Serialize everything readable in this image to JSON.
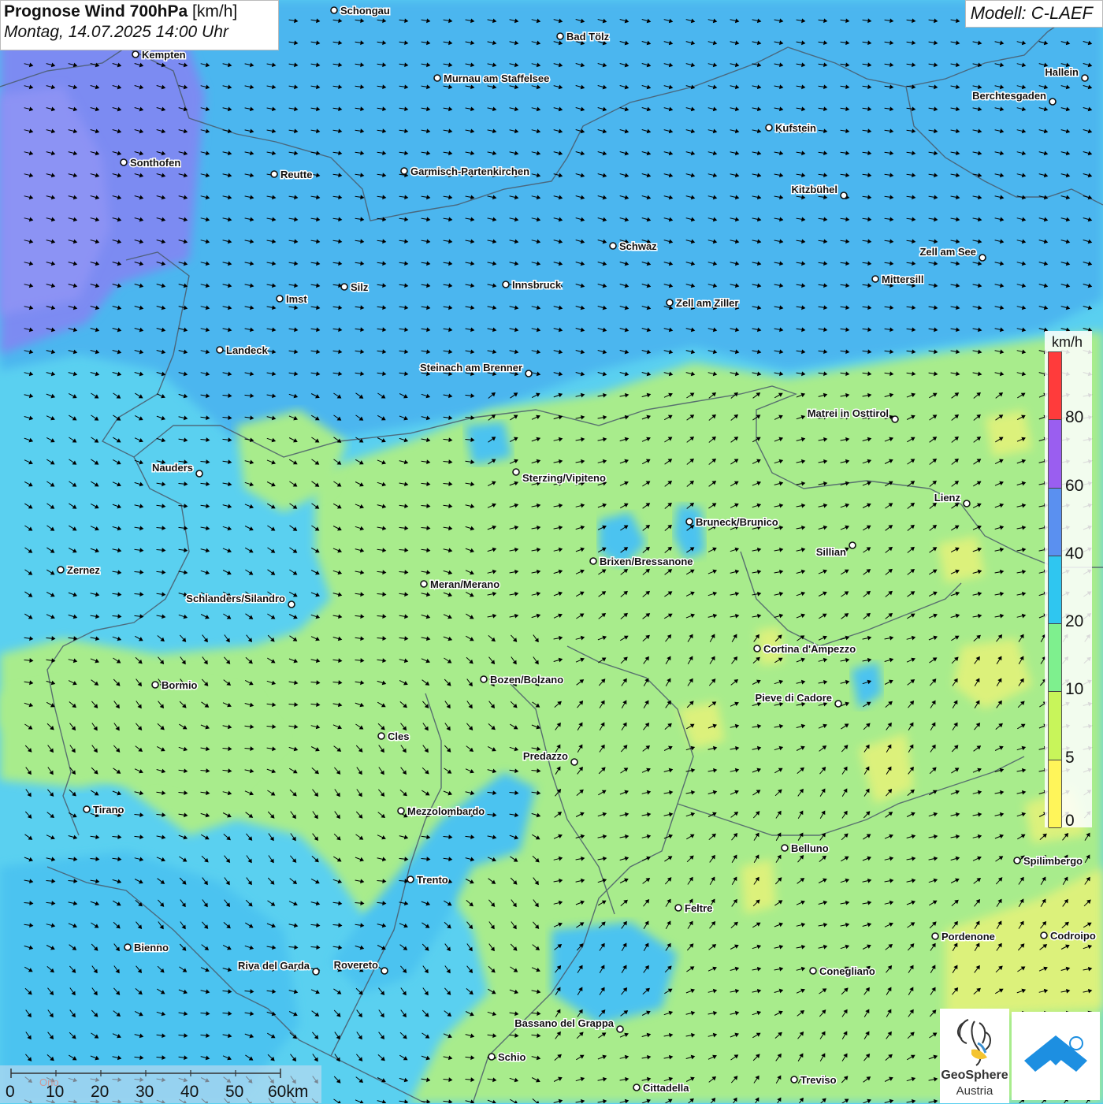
{
  "header": {
    "title_bold": "Prognose Wind 700hPa",
    "title_unit": "[km/h]",
    "datetime": "Montag, 14.07.2025 14:00 Uhr"
  },
  "model_label": "Modell: C-LAEF",
  "legend": {
    "unit": "km/h",
    "ticks": [
      "80",
      "60",
      "40",
      "20",
      "10",
      "5",
      "0"
    ],
    "colors": [
      "#ff3b3b",
      "#9a5ef0",
      "#5a90f0",
      "#2fc6f0",
      "#7ef08e",
      "#c8f55a",
      "#fff55a"
    ]
  },
  "scalebar": {
    "labels": [
      "0",
      "10",
      "20",
      "30",
      "40",
      "50",
      "60km"
    ],
    "faint_text": "Orio"
  },
  "logos": {
    "geosphere_line1": "GeoSphere",
    "geosphere_line2": "Austria"
  },
  "colors": {
    "calm_yellow": "#e8f27a",
    "light_green": "#a8ec8c",
    "cyan": "#5ad0f0",
    "blue": "#4bb8f0",
    "purple": "#7a8cf0",
    "border": "#4a5a6a",
    "arrow": "#000000"
  },
  "cities": [
    {
      "name": "Schongau"
    },
    {
      "name": "Bad Tölz"
    },
    {
      "name": "Kempten"
    },
    {
      "name": "Murnau am Staffelsee"
    },
    {
      "name": "Hallein"
    },
    {
      "name": "Berchtesgaden"
    },
    {
      "name": "Kufstein"
    },
    {
      "name": "Sonthofen"
    },
    {
      "name": "Reutte"
    },
    {
      "name": "Garmisch-Partenkirchen"
    },
    {
      "name": "Kitzbühel"
    },
    {
      "name": "Schwaz"
    },
    {
      "name": "Zell am See"
    },
    {
      "name": "Mittersill"
    },
    {
      "name": "Innsbruck"
    },
    {
      "name": "Silz"
    },
    {
      "name": "Imst"
    },
    {
      "name": "Zell am Ziller"
    },
    {
      "name": "Landeck"
    },
    {
      "name": "Steinach am Brenner"
    },
    {
      "name": "Matrei in Osttirol"
    },
    {
      "name": "Nauders"
    },
    {
      "name": "Sterzing/Vipiteno"
    },
    {
      "name": "Lienz"
    },
    {
      "name": "Bruneck/Brunico"
    },
    {
      "name": "Sillian"
    },
    {
      "name": "Zernez"
    },
    {
      "name": "Brixen/Bressanone"
    },
    {
      "name": "Meran/Merano"
    },
    {
      "name": "Schlanders/Silandro"
    },
    {
      "name": "Cortina d'Ampezzo"
    },
    {
      "name": "Bozen/Bolzano"
    },
    {
      "name": "Bormio"
    },
    {
      "name": "Pieve di Cadore"
    },
    {
      "name": "Cles"
    },
    {
      "name": "Predazzo"
    },
    {
      "name": "Tirano"
    },
    {
      "name": "Mezzolombardo"
    },
    {
      "name": "Belluno"
    },
    {
      "name": "Spilimbergo"
    },
    {
      "name": "Trento"
    },
    {
      "name": "Feltre"
    },
    {
      "name": "Pordenone"
    },
    {
      "name": "Codroipo"
    },
    {
      "name": "Bienno"
    },
    {
      "name": "Riva del Garda"
    },
    {
      "name": "Rovereto"
    },
    {
      "name": "Conegliano"
    },
    {
      "name": "Bassano del Grappa"
    },
    {
      "name": "Schio"
    },
    {
      "name": "Treviso"
    },
    {
      "name": "Cittadella"
    }
  ]
}
